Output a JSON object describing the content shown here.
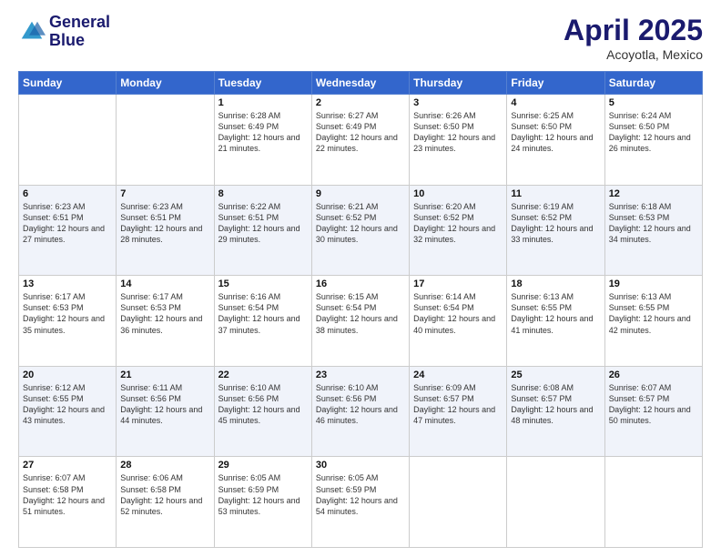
{
  "logo": {
    "line1": "General",
    "line2": "Blue"
  },
  "title": "April 2025",
  "subtitle": "Acoyotla, Mexico",
  "days_of_week": [
    "Sunday",
    "Monday",
    "Tuesday",
    "Wednesday",
    "Thursday",
    "Friday",
    "Saturday"
  ],
  "weeks": [
    [
      {
        "day": "",
        "sunrise": "",
        "sunset": "",
        "daylight": ""
      },
      {
        "day": "",
        "sunrise": "",
        "sunset": "",
        "daylight": ""
      },
      {
        "day": "1",
        "sunrise": "Sunrise: 6:28 AM",
        "sunset": "Sunset: 6:49 PM",
        "daylight": "Daylight: 12 hours and 21 minutes."
      },
      {
        "day": "2",
        "sunrise": "Sunrise: 6:27 AM",
        "sunset": "Sunset: 6:49 PM",
        "daylight": "Daylight: 12 hours and 22 minutes."
      },
      {
        "day": "3",
        "sunrise": "Sunrise: 6:26 AM",
        "sunset": "Sunset: 6:50 PM",
        "daylight": "Daylight: 12 hours and 23 minutes."
      },
      {
        "day": "4",
        "sunrise": "Sunrise: 6:25 AM",
        "sunset": "Sunset: 6:50 PM",
        "daylight": "Daylight: 12 hours and 24 minutes."
      },
      {
        "day": "5",
        "sunrise": "Sunrise: 6:24 AM",
        "sunset": "Sunset: 6:50 PM",
        "daylight": "Daylight: 12 hours and 26 minutes."
      }
    ],
    [
      {
        "day": "6",
        "sunrise": "Sunrise: 6:23 AM",
        "sunset": "Sunset: 6:51 PM",
        "daylight": "Daylight: 12 hours and 27 minutes."
      },
      {
        "day": "7",
        "sunrise": "Sunrise: 6:23 AM",
        "sunset": "Sunset: 6:51 PM",
        "daylight": "Daylight: 12 hours and 28 minutes."
      },
      {
        "day": "8",
        "sunrise": "Sunrise: 6:22 AM",
        "sunset": "Sunset: 6:51 PM",
        "daylight": "Daylight: 12 hours and 29 minutes."
      },
      {
        "day": "9",
        "sunrise": "Sunrise: 6:21 AM",
        "sunset": "Sunset: 6:52 PM",
        "daylight": "Daylight: 12 hours and 30 minutes."
      },
      {
        "day": "10",
        "sunrise": "Sunrise: 6:20 AM",
        "sunset": "Sunset: 6:52 PM",
        "daylight": "Daylight: 12 hours and 32 minutes."
      },
      {
        "day": "11",
        "sunrise": "Sunrise: 6:19 AM",
        "sunset": "Sunset: 6:52 PM",
        "daylight": "Daylight: 12 hours and 33 minutes."
      },
      {
        "day": "12",
        "sunrise": "Sunrise: 6:18 AM",
        "sunset": "Sunset: 6:53 PM",
        "daylight": "Daylight: 12 hours and 34 minutes."
      }
    ],
    [
      {
        "day": "13",
        "sunrise": "Sunrise: 6:17 AM",
        "sunset": "Sunset: 6:53 PM",
        "daylight": "Daylight: 12 hours and 35 minutes."
      },
      {
        "day": "14",
        "sunrise": "Sunrise: 6:17 AM",
        "sunset": "Sunset: 6:53 PM",
        "daylight": "Daylight: 12 hours and 36 minutes."
      },
      {
        "day": "15",
        "sunrise": "Sunrise: 6:16 AM",
        "sunset": "Sunset: 6:54 PM",
        "daylight": "Daylight: 12 hours and 37 minutes."
      },
      {
        "day": "16",
        "sunrise": "Sunrise: 6:15 AM",
        "sunset": "Sunset: 6:54 PM",
        "daylight": "Daylight: 12 hours and 38 minutes."
      },
      {
        "day": "17",
        "sunrise": "Sunrise: 6:14 AM",
        "sunset": "Sunset: 6:54 PM",
        "daylight": "Daylight: 12 hours and 40 minutes."
      },
      {
        "day": "18",
        "sunrise": "Sunrise: 6:13 AM",
        "sunset": "Sunset: 6:55 PM",
        "daylight": "Daylight: 12 hours and 41 minutes."
      },
      {
        "day": "19",
        "sunrise": "Sunrise: 6:13 AM",
        "sunset": "Sunset: 6:55 PM",
        "daylight": "Daylight: 12 hours and 42 minutes."
      }
    ],
    [
      {
        "day": "20",
        "sunrise": "Sunrise: 6:12 AM",
        "sunset": "Sunset: 6:55 PM",
        "daylight": "Daylight: 12 hours and 43 minutes."
      },
      {
        "day": "21",
        "sunrise": "Sunrise: 6:11 AM",
        "sunset": "Sunset: 6:56 PM",
        "daylight": "Daylight: 12 hours and 44 minutes."
      },
      {
        "day": "22",
        "sunrise": "Sunrise: 6:10 AM",
        "sunset": "Sunset: 6:56 PM",
        "daylight": "Daylight: 12 hours and 45 minutes."
      },
      {
        "day": "23",
        "sunrise": "Sunrise: 6:10 AM",
        "sunset": "Sunset: 6:56 PM",
        "daylight": "Daylight: 12 hours and 46 minutes."
      },
      {
        "day": "24",
        "sunrise": "Sunrise: 6:09 AM",
        "sunset": "Sunset: 6:57 PM",
        "daylight": "Daylight: 12 hours and 47 minutes."
      },
      {
        "day": "25",
        "sunrise": "Sunrise: 6:08 AM",
        "sunset": "Sunset: 6:57 PM",
        "daylight": "Daylight: 12 hours and 48 minutes."
      },
      {
        "day": "26",
        "sunrise": "Sunrise: 6:07 AM",
        "sunset": "Sunset: 6:57 PM",
        "daylight": "Daylight: 12 hours and 50 minutes."
      }
    ],
    [
      {
        "day": "27",
        "sunrise": "Sunrise: 6:07 AM",
        "sunset": "Sunset: 6:58 PM",
        "daylight": "Daylight: 12 hours and 51 minutes."
      },
      {
        "day": "28",
        "sunrise": "Sunrise: 6:06 AM",
        "sunset": "Sunset: 6:58 PM",
        "daylight": "Daylight: 12 hours and 52 minutes."
      },
      {
        "day": "29",
        "sunrise": "Sunrise: 6:05 AM",
        "sunset": "Sunset: 6:59 PM",
        "daylight": "Daylight: 12 hours and 53 minutes."
      },
      {
        "day": "30",
        "sunrise": "Sunrise: 6:05 AM",
        "sunset": "Sunset: 6:59 PM",
        "daylight": "Daylight: 12 hours and 54 minutes."
      },
      {
        "day": "",
        "sunrise": "",
        "sunset": "",
        "daylight": ""
      },
      {
        "day": "",
        "sunrise": "",
        "sunset": "",
        "daylight": ""
      },
      {
        "day": "",
        "sunrise": "",
        "sunset": "",
        "daylight": ""
      }
    ]
  ]
}
